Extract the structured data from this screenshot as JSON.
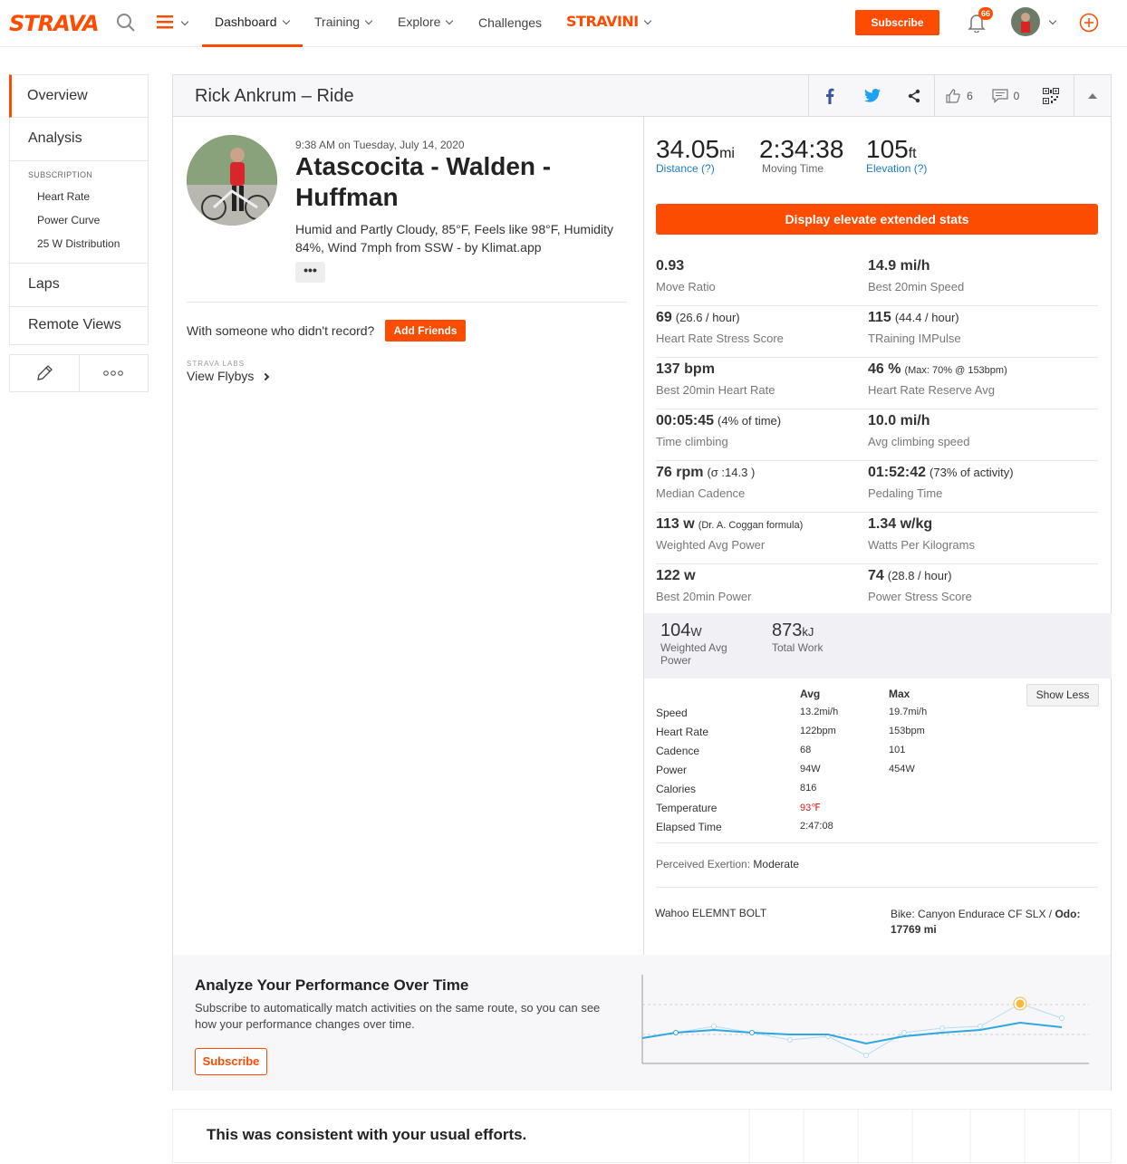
{
  "nav": {
    "logo": "STRAVA",
    "dashboard": "Dashboard",
    "training": "Training",
    "explore": "Explore",
    "challenges": "Challenges",
    "stravini": "STRAVINI",
    "subscribe": "Subscribe",
    "notif_count": "66",
    "accent": "#fc4c02"
  },
  "sidebar": {
    "overview": "Overview",
    "analysis": "Analysis",
    "subscription_caption": "SUBSCRIPTION",
    "heart_rate": "Heart Rate",
    "power_curve": "Power Curve",
    "distribution": "25 W Distribution",
    "laps": "Laps",
    "remote_views": "Remote Views"
  },
  "header": {
    "title": "Rick Ankrum – Ride",
    "kudos": "6",
    "comments": "0"
  },
  "activity": {
    "time": "9:38 AM on Tuesday, July 14, 2020",
    "title": "Atascocita - Walden - Huffman",
    "weather": "Humid and Partly Cloudy, 85°F, Feels like 98°F, Humidity 84%, Wind 7mph from SSW - by Klimat.app",
    "more": "•••",
    "with_someone": "With someone who didn't record?",
    "add_friends": "Add Friends",
    "labs": "STRAVA LABS",
    "flybys": "View Flybys"
  },
  "stats": {
    "distance": {
      "value": "34.05",
      "unit": "mi",
      "label": "Distance (?)"
    },
    "moving": {
      "value": "2:34:38",
      "label": "Moving Time"
    },
    "elevation": {
      "value": "105",
      "unit": "ft",
      "label": "Elevation (?)"
    },
    "elevate_button": "Display elevate extended stats"
  },
  "grid": [
    {
      "left": {
        "val": "0.93",
        "extra": "",
        "label": "Move Ratio"
      },
      "right": {
        "val": "14.9 mi/h",
        "extra": "",
        "label": "Best 20min Speed"
      }
    },
    {
      "left": {
        "val": "69",
        "extra": "(26.6 / hour)",
        "label": "Heart Rate Stress Score"
      },
      "right": {
        "val": "115",
        "extra": "(44.4 / hour)",
        "label": "TRaining IMPulse"
      }
    },
    {
      "left": {
        "val": "137 bpm",
        "extra": "",
        "label": "Best 20min Heart Rate"
      },
      "right": {
        "val": "46 %",
        "extra": "(Max: 70% @ 153bpm)",
        "label": "Heart Rate Reserve Avg"
      }
    },
    {
      "left": {
        "val": "00:05:45",
        "extra": "(4% of time)",
        "label": "Time climbing"
      },
      "right": {
        "val": "10.0 mi/h",
        "extra": "",
        "label": "Avg climbing speed"
      }
    },
    {
      "left": {
        "val": "76 rpm",
        "extra": "(σ :14.3 )",
        "label": "Median Cadence"
      },
      "right": {
        "val": "01:52:42",
        "extra": "(73% of activity)",
        "label": "Pedaling Time"
      }
    },
    {
      "left": {
        "val": "113 w",
        "extra": "(Dr. A. Coggan formula)",
        "label": "Weighted Avg Power"
      },
      "right": {
        "val": "1.34 w/kg",
        "extra": "",
        "label": "Watts Per Kilograms"
      }
    },
    {
      "left": {
        "val": "122 w",
        "extra": "",
        "label": "Best 20min Power"
      },
      "right": {
        "val": "74",
        "extra": "(28.8 / hour)",
        "label": "Power Stress Score"
      }
    }
  ],
  "power": {
    "wap_value": "104",
    "wap_unit": "W",
    "wap_label": "Weighted Avg Power",
    "work_value": "873",
    "work_unit": "kJ",
    "work_label": "Total Work"
  },
  "table": {
    "avg": "Avg",
    "max": "Max",
    "show_less": "Show Less",
    "rows": [
      {
        "name": "Speed",
        "avg": "13.2mi/h",
        "max": "19.7mi/h"
      },
      {
        "name": "Heart Rate",
        "avg": "122bpm",
        "max": "153bpm"
      },
      {
        "name": "Cadence",
        "avg": "68",
        "max": "101"
      },
      {
        "name": "Power",
        "avg": "94W",
        "max": "454W"
      },
      {
        "name": "Calories",
        "avg": "816",
        "max": ""
      },
      {
        "name": "Temperature",
        "avg": "93℉",
        "max": ""
      },
      {
        "name": "Elapsed Time",
        "avg": "2:47:08",
        "max": ""
      }
    ]
  },
  "exertion": {
    "label": "Perceived Exertion:",
    "value": "Moderate"
  },
  "device": "Wahoo ELEMNT BOLT",
  "bike": {
    "label": "Bike:",
    "name": "Canyon Endurace CF SLX /",
    "odo_label": "Odo:",
    "odo": "17769 mi"
  },
  "promo": {
    "title": "Analyze Your Performance Over Time",
    "text": "Subscribe to automatically match activities on the same route, so you can see how your performance changes over time.",
    "button": "Subscribe"
  },
  "bottom": {
    "text": "This was consistent with your usual efforts."
  }
}
